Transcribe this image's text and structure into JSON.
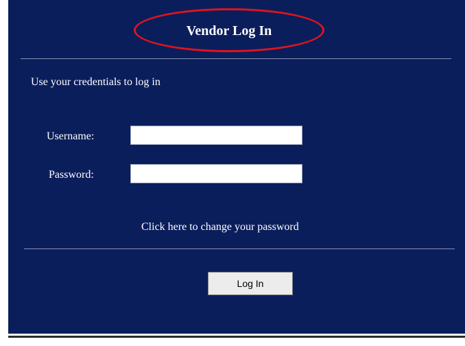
{
  "header": {
    "title": "Vendor Log In"
  },
  "form": {
    "intro": "Use your credentials to log in",
    "username_label": "Username:",
    "username_value": "",
    "password_label": "Password:",
    "password_value": "",
    "change_password_link": "Click here to change your password",
    "login_button": "Log In"
  },
  "colors": {
    "panel_background": "#0b1e5c",
    "highlight_ellipse": "#e0141c",
    "text": "#ffffff"
  }
}
